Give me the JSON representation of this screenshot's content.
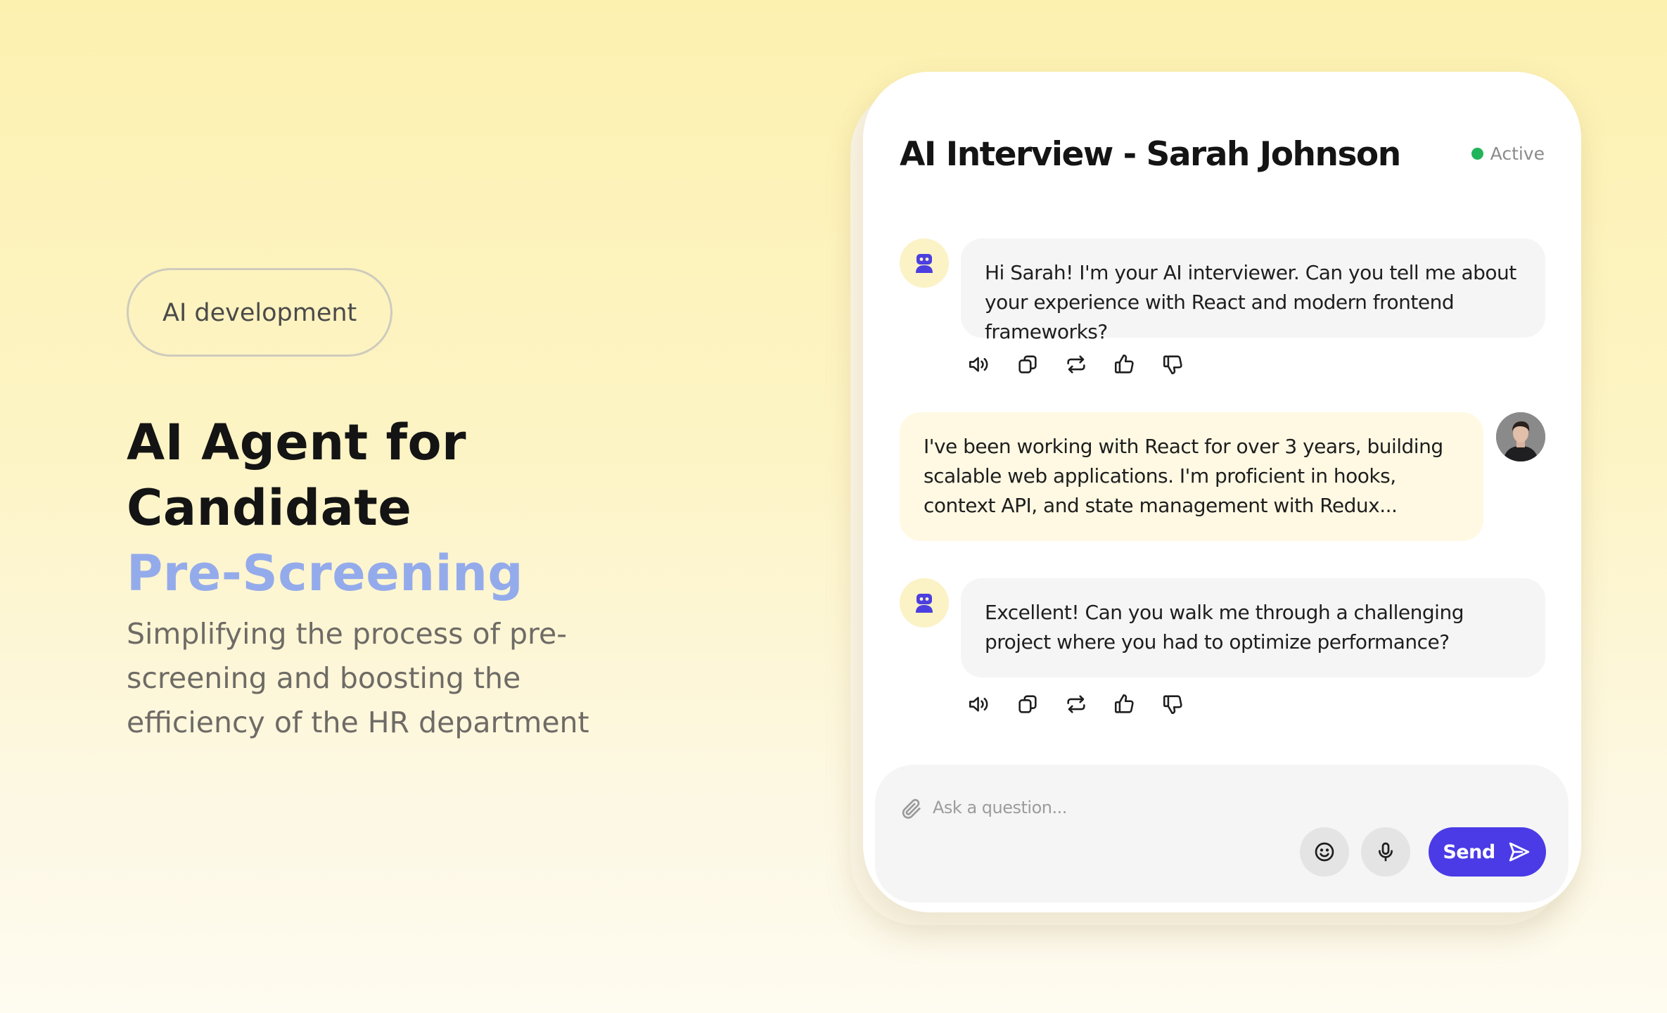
{
  "hero": {
    "tag": "AI development",
    "title_line1": "AI Agent for",
    "title_line2": "Candidate",
    "title_accent": "Pre-Screening",
    "subtitle": "Simplifying the process of pre-screening and boosting the efficiency of the HR department"
  },
  "chat": {
    "title": "AI Interview - Sarah Johnson",
    "status": "Active",
    "messages": [
      {
        "role": "ai",
        "text": "Hi Sarah! I'm your AI interviewer. Can you tell me about your experience with React and modern frontend frameworks?"
      },
      {
        "role": "user",
        "text": "I've been working with React for over 3 years, building scalable web applications. I'm proficient in hooks, context API, and state management with Redux..."
      },
      {
        "role": "ai",
        "text": "Excellent! Can you walk me through a challenging project where you had to optimize performance?"
      }
    ],
    "message_actions": [
      "speaker-icon",
      "copy-icon",
      "regenerate-icon",
      "thumbs-up-icon",
      "thumbs-down-icon"
    ]
  },
  "composer": {
    "placeholder": "Ask a question...",
    "send_label": "Send"
  },
  "colors": {
    "accent": "#4a3be6",
    "hero_accent": "#94abeb",
    "status": "#22b45a",
    "bot_icon": "#4b3fe0"
  }
}
